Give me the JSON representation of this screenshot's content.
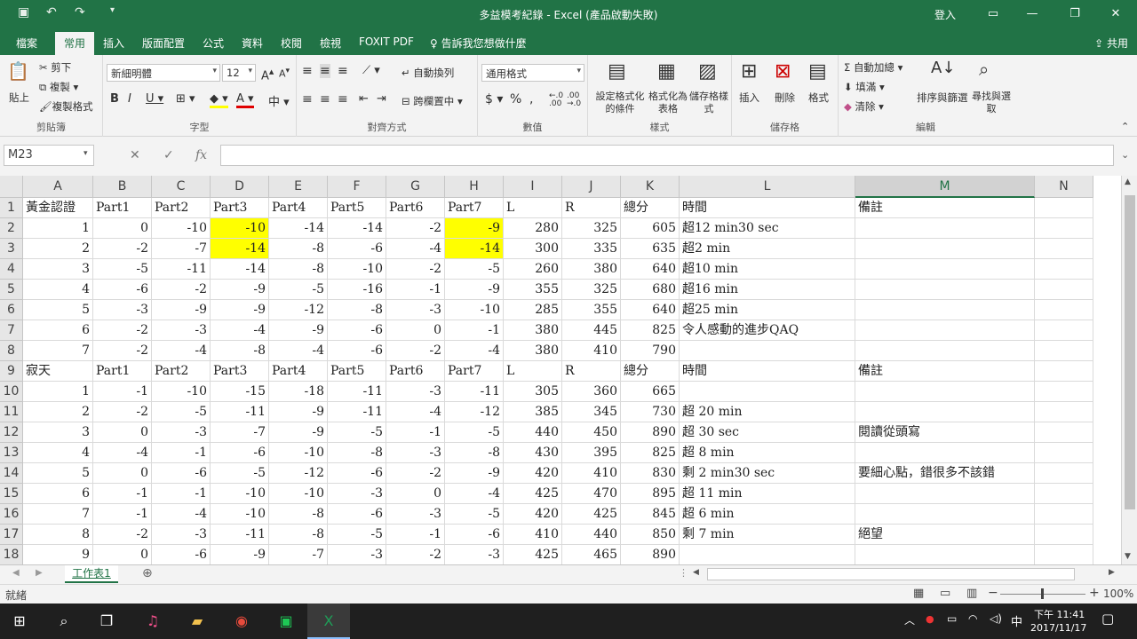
{
  "window": {
    "title": "多益模考紀錄  -  Excel (產品啟動失敗)",
    "signin": "登入"
  },
  "tabs": [
    "檔案",
    "常用",
    "插入",
    "版面配置",
    "公式",
    "資料",
    "校閱",
    "檢視",
    "FOXIT PDF",
    "告訴我您想做什麼"
  ],
  "active_tab": "常用",
  "share": "共用",
  "ribbon": {
    "clipboard": {
      "paste": "貼上",
      "cut": "剪下",
      "copy": "複製",
      "format_painter": "複製格式",
      "label": "剪貼簿"
    },
    "font": {
      "name": "新細明體",
      "size": "12",
      "label": "字型"
    },
    "alignment": {
      "wrap": "自動換列",
      "merge": "跨欄置中",
      "label": "對齊方式"
    },
    "number": {
      "format": "通用格式",
      "label": "數值"
    },
    "styles": {
      "cond": "設定格式化的條件",
      "table": "格式化為表格",
      "cell": "儲存格樣式",
      "label": "樣式"
    },
    "cells": {
      "insert": "插入",
      "delete": "刪除",
      "format": "格式",
      "label": "儲存格"
    },
    "editing": {
      "autosum": "自動加總",
      "fill": "填滿",
      "clear": "清除",
      "sort": "排序與篩選",
      "find": "尋找與選取",
      "label": "編輯"
    }
  },
  "namebox": "M23",
  "fx": "fx",
  "columns": [
    "A",
    "B",
    "C",
    "D",
    "E",
    "F",
    "G",
    "H",
    "I",
    "J",
    "K",
    "L",
    "M",
    "N"
  ],
  "rows": [
    [
      "黃金認證",
      "Part1",
      "Part2",
      "Part3",
      "Part4",
      "Part5",
      "Part6",
      "Part7",
      "L",
      "R",
      "總分",
      "時間",
      "備註"
    ],
    [
      "1",
      "0",
      "-10",
      "-10",
      "-14",
      "-14",
      "-2",
      "-9",
      "280",
      "325",
      "605",
      "超12 min30 sec",
      ""
    ],
    [
      "2",
      "-2",
      "-7",
      "-14",
      "-8",
      "-6",
      "-4",
      "-14",
      "300",
      "335",
      "635",
      "超2 min",
      ""
    ],
    [
      "3",
      "-5",
      "-11",
      "-14",
      "-8",
      "-10",
      "-2",
      "-5",
      "260",
      "380",
      "640",
      "超10 min",
      ""
    ],
    [
      "4",
      "-6",
      "-2",
      "-9",
      "-5",
      "-16",
      "-1",
      "-9",
      "355",
      "325",
      "680",
      "超16 min",
      ""
    ],
    [
      "5",
      "-3",
      "-9",
      "-9",
      "-12",
      "-8",
      "-3",
      "-10",
      "285",
      "355",
      "640",
      "超25 min",
      ""
    ],
    [
      "6",
      "-2",
      "-3",
      "-4",
      "-9",
      "-6",
      "0",
      "-1",
      "380",
      "445",
      "825",
      "令人感動的進步QAQ",
      ""
    ],
    [
      "7",
      "-2",
      "-4",
      "-8",
      "-4",
      "-6",
      "-2",
      "-4",
      "380",
      "410",
      "790",
      "",
      ""
    ],
    [
      "寂天",
      "Part1",
      "Part2",
      "Part3",
      "Part4",
      "Part5",
      "Part6",
      "Part7",
      "L",
      "R",
      "總分",
      "時間",
      "備註"
    ],
    [
      "1",
      "-1",
      "-10",
      "-15",
      "-18",
      "-11",
      "-3",
      "-11",
      "305",
      "360",
      "665",
      "",
      ""
    ],
    [
      "2",
      "-2",
      "-5",
      "-11",
      "-9",
      "-11",
      "-4",
      "-12",
      "385",
      "345",
      "730",
      "超 20 min",
      ""
    ],
    [
      "3",
      "0",
      "-3",
      "-7",
      "-9",
      "-5",
      "-1",
      "-5",
      "440",
      "450",
      "890",
      "超 30 sec",
      "閱讀從頭寫"
    ],
    [
      "4",
      "-4",
      "-1",
      "-6",
      "-10",
      "-8",
      "-3",
      "-8",
      "430",
      "395",
      "825",
      "超 8 min",
      ""
    ],
    [
      "5",
      "0",
      "-6",
      "-5",
      "-12",
      "-6",
      "-2",
      "-9",
      "420",
      "410",
      "830",
      "剩 2 min30 sec",
      "要細心點，錯很多不該錯"
    ],
    [
      "6",
      "-1",
      "-1",
      "-10",
      "-10",
      "-3",
      "0",
      "-4",
      "425",
      "470",
      "895",
      "超 11 min",
      ""
    ],
    [
      "7",
      "-1",
      "-4",
      "-10",
      "-8",
      "-6",
      "-3",
      "-5",
      "420",
      "425",
      "845",
      "超 6 min",
      ""
    ],
    [
      "8",
      "-2",
      "-3",
      "-11",
      "-8",
      "-5",
      "-1",
      "-6",
      "410",
      "440",
      "850",
      "剩 7 min",
      "絕望"
    ],
    [
      "9",
      "0",
      "-6",
      "-9",
      "-7",
      "-3",
      "-2",
      "-3",
      "425",
      "465",
      "890",
      "",
      ""
    ]
  ],
  "highlight_color": "#ffff00",
  "sheet_tab": "工作表1",
  "status": {
    "ready": "就緒",
    "zoom": "100%"
  },
  "taskbar": {
    "time": "下午 11:41",
    "date": "2017/11/17",
    "ime": "中"
  }
}
